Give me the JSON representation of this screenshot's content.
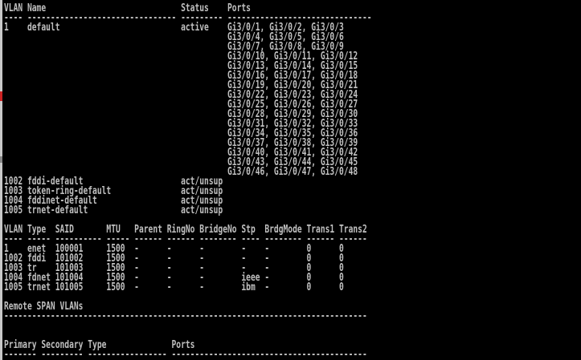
{
  "colors": {
    "background": "#000000",
    "text": "#c0c0c0"
  },
  "lines": [
    "VLAN Name                             Status    Ports",
    "---- -------------------------------- --------- -------------------------------",
    "1    default                          active    Gi3/0/1, Gi3/0/2, Gi3/0/3",
    "                                                Gi3/0/4, Gi3/0/5, Gi3/0/6",
    "                                                Gi3/0/7, Gi3/0/8, Gi3/0/9",
    "                                                Gi3/0/10, Gi3/0/11, Gi3/0/12",
    "                                                Gi3/0/13, Gi3/0/14, Gi3/0/15",
    "                                                Gi3/0/16, Gi3/0/17, Gi3/0/18",
    "                                                Gi3/0/19, Gi3/0/20, Gi3/0/21",
    "                                                Gi3/0/22, Gi3/0/23, Gi3/0/24",
    "                                                Gi3/0/25, Gi3/0/26, Gi3/0/27",
    "                                                Gi3/0/28, Gi3/0/29, Gi3/0/30",
    "                                                Gi3/0/31, Gi3/0/32, Gi3/0/33",
    "                                                Gi3/0/34, Gi3/0/35, Gi3/0/36",
    "                                                Gi3/0/37, Gi3/0/38, Gi3/0/39",
    "                                                Gi3/0/40, Gi3/0/41, Gi3/0/42",
    "                                                Gi3/0/43, Gi3/0/44, Gi3/0/45",
    "                                                Gi3/0/46, Gi3/0/47, Gi3/0/48",
    "1002 fddi-default                     act/unsup",
    "1003 token-ring-default               act/unsup",
    "1004 fddinet-default                  act/unsup",
    "1005 trnet-default                    act/unsup",
    "",
    "VLAN Type  SAID       MTU   Parent RingNo BridgeNo Stp  BrdgMode Trans1 Trans2",
    "---- ----- ---------- ----- ------ ------ -------- ---- -------- ------ ------",
    "1    enet  100001     1500  -      -      -        -    -        0      0",
    "1002 fddi  101002     1500  -      -      -        -    -        0      0",
    "1003 tr    101003     1500  -      -      -        -    -        0      0",
    "1004 fdnet 101004     1500  -      -      -        ieee -        0      0",
    "1005 trnet 101005     1500  -      -      -        ibm  -        0      0",
    "",
    "Remote SPAN VLANs",
    "------------------------------------------------------------------------------",
    "",
    "",
    "Primary Secondary Type              Ports",
    "------- --------- ----------------- ------------------------------------------"
  ]
}
